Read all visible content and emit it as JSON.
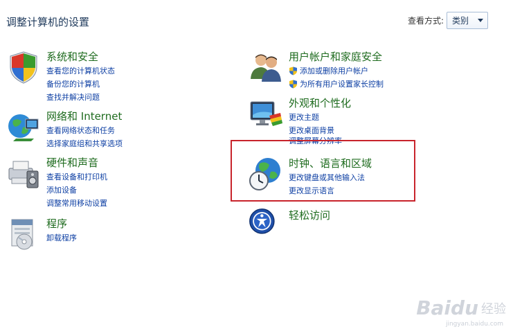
{
  "header": {
    "title": "调整计算机的设置",
    "view_by_label": "查看方式:",
    "view_by_value": "类别"
  },
  "categories": {
    "system": {
      "title": "系统和安全",
      "links": [
        "查看您的计算机状态",
        "备份您的计算机",
        "查找并解决问题"
      ]
    },
    "network": {
      "title": "网络和 Internet",
      "links": [
        "查看网络状态和任务",
        "选择家庭组和共享选项"
      ]
    },
    "hardware": {
      "title": "硬件和声音",
      "links": [
        "查看设备和打印机",
        "添加设备",
        "调整常用移动设置"
      ]
    },
    "programs": {
      "title": "程序",
      "links": [
        "卸载程序"
      ]
    },
    "users": {
      "title": "用户帐户和家庭安全",
      "links": [
        "添加或删除用户帐户",
        "为所有用户设置家长控制"
      ]
    },
    "appearance": {
      "title": "外观和个性化",
      "links": [
        "更改主题",
        "更改桌面背景",
        "调整屏幕分辨率"
      ]
    },
    "clock": {
      "title": "时钟、语言和区域",
      "links": [
        "更改键盘或其他输入法",
        "更改显示语言"
      ]
    },
    "ease": {
      "title": "轻松访问",
      "links": []
    }
  },
  "watermark": {
    "brand": "Baidu",
    "sub": "经验",
    "url": "jingyan.baidu.com"
  },
  "colors": {
    "category_title": "#1e6b1e",
    "link": "#0d3fa3",
    "highlight": "#c8232b"
  }
}
